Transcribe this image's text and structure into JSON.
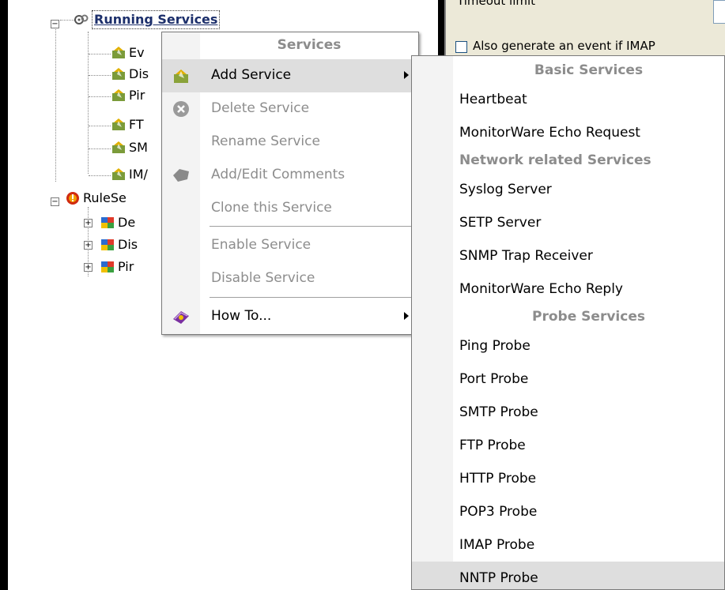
{
  "tree": {
    "running_services": "Running Services",
    "services": [
      "Ev",
      "Dis",
      "Pir",
      "FT",
      "SM",
      "IM/"
    ],
    "ruleset_root": "RuleSe",
    "rulesets": [
      "De",
      "Dis",
      "Pir"
    ]
  },
  "right_panel": {
    "timeout_label": "Timeout limit",
    "also_label": "Also generate an event if IMAP"
  },
  "context_menu": {
    "title": "Services",
    "items": {
      "add_service": "Add Service",
      "delete_service": "Delete Service",
      "rename_service": "Rename Service",
      "add_edit_comments": "Add/Edit Comments",
      "clone_service": "Clone this Service",
      "enable_service": "Enable Service",
      "disable_service": "Disable Service",
      "how_to": "How To..."
    }
  },
  "submenu": {
    "basic_header": "Basic Services",
    "basic_items": [
      "Heartbeat",
      "MonitorWare Echo Request"
    ],
    "network_header": "Network related Services",
    "network_items": [
      "Syslog Server",
      "SETP Server",
      "SNMP Trap Receiver",
      "MonitorWare Echo Reply"
    ],
    "probe_header": "Probe Services",
    "probe_items": [
      "Ping Probe",
      "Port Probe",
      "SMTP Probe",
      "FTP Probe",
      "HTTP Probe",
      "POP3 Probe",
      "IMAP Probe",
      "NNTP Probe"
    ]
  },
  "colors": {
    "menu_hover": "#dedede",
    "disabled_text": "#8d8d8d",
    "header_text": "#8c8c8c",
    "selection_text": "#1c2f6b"
  }
}
